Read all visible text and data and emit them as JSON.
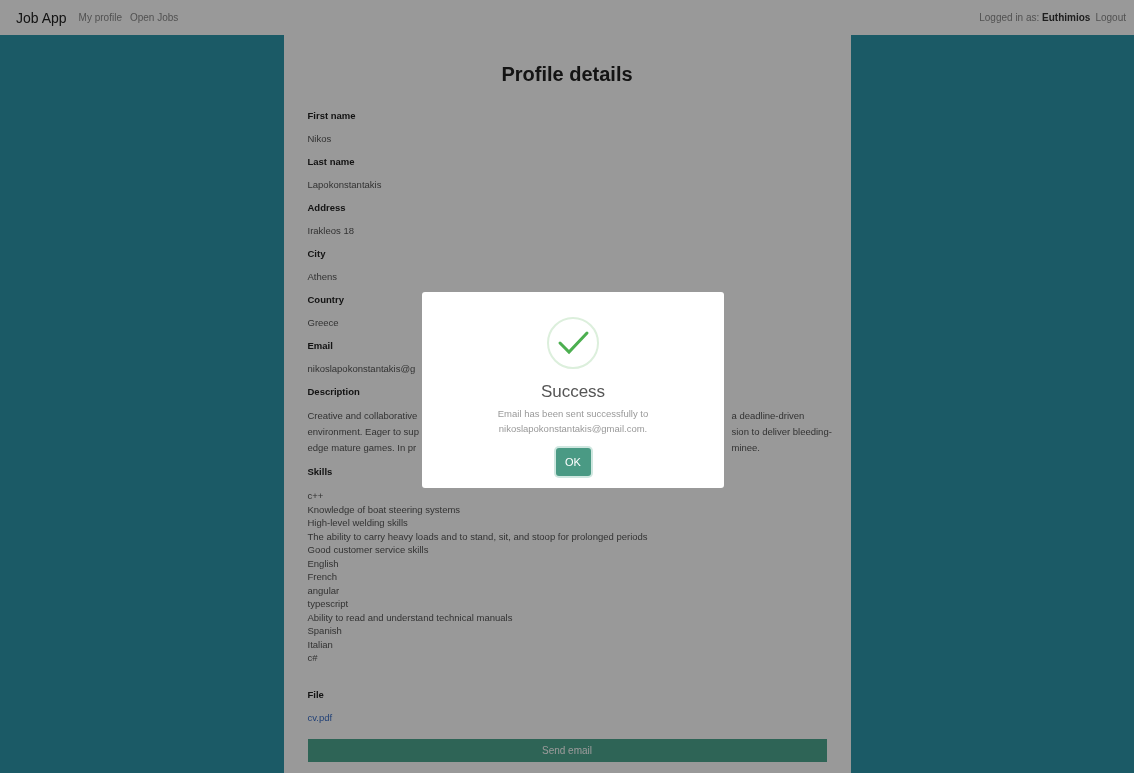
{
  "navbar": {
    "brand": "Job App",
    "links": [
      {
        "label": "My profile"
      },
      {
        "label": "Open Jobs"
      }
    ],
    "status": "Logged in as: **Euthimios**",
    "logout": "Logout"
  },
  "profile": {
    "title": "Profile details",
    "fields": [
      {
        "label": "First name",
        "value": "Nikos"
      },
      {
        "label": "Last name",
        "value": "Lapokonstantakis"
      },
      {
        "label": "Address",
        "value": "Irakleos 18"
      },
      {
        "label": "City",
        "value": "Athens"
      },
      {
        "label": "Country",
        "value": "Greece"
      },
      {
        "label": "Email",
        "value": "nikoslapokonstantakis@g"
      }
    ],
    "description": {
      "label": "Description",
      "lines": [
        {
          "left": "Creative and collaborative",
          "right": "a deadline-driven"
        },
        {
          "left": "environment. Eager to sup",
          "right": "sion to deliver bleeding-"
        },
        {
          "left": "edge mature games. In pr",
          "right": "minee."
        }
      ]
    },
    "skills": {
      "label": "Skills",
      "items": [
        "c++",
        "Knowledge of boat steering systems",
        "High-level welding skills",
        "The ability to carry heavy loads and to stand, sit, and stoop for prolonged periods",
        "Good customer service skills",
        "English",
        "French",
        "angular",
        "typescript",
        "Ability to read and understand technical manuals",
        "Spanish",
        "Italian",
        "c#"
      ]
    },
    "file": {
      "label": "File",
      "link": "cv.pdf"
    },
    "send_button": "Send email"
  },
  "dialog": {
    "title": "Success",
    "message": "Email has been sent successfully to nikoslapokonstantakis@gmail.com.",
    "button": "OK"
  }
}
